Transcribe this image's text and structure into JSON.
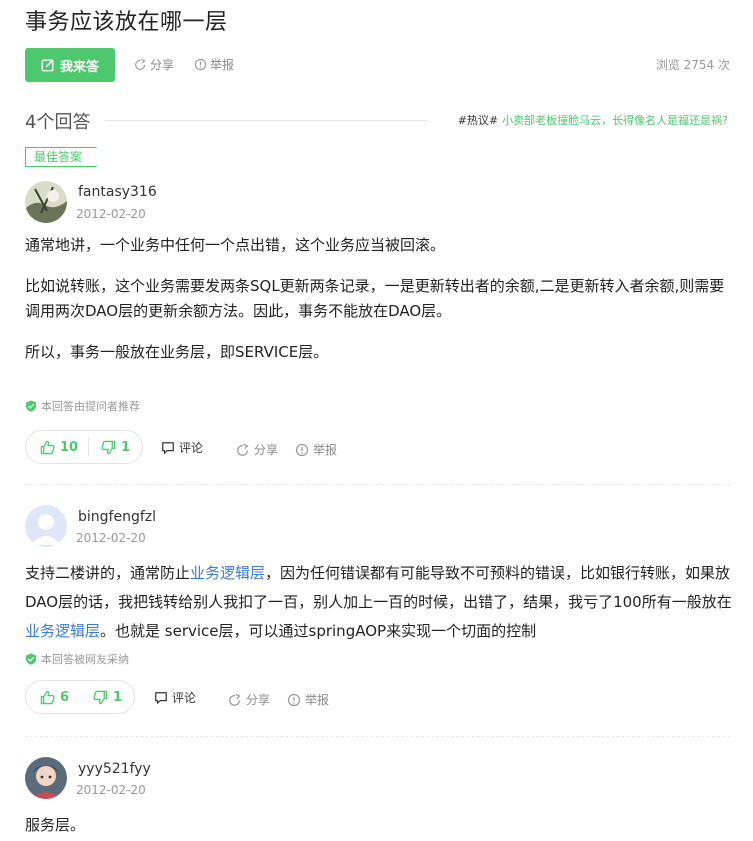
{
  "question": {
    "title": "事务应该放在哪一层",
    "answer_button": "我来答",
    "share": "分享",
    "report": "举报",
    "views": "浏览 2754 次"
  },
  "answers_header": {
    "count": "4个回答",
    "hot_tag": "#热议#",
    "hot_link": "小卖部老板撞脸马云，长得像名人是福还是祸?"
  },
  "best_badge": "最佳答案",
  "answers": [
    {
      "username": "fantasy316",
      "date": "2012-02-20",
      "paragraphs": [
        "通常地讲，一个业务中任何一个点出错，这个业务应当被回滚。",
        "比如说转账，这个业务需要发两条SQL更新两条记录，一是更新转出者的余额,二是更新转入者余额,则需要调用两次DAO层的更新余额方法。因此，事务不能放在DAO层。",
        "所以，事务一般放在业务层，即SERVICE层。"
      ],
      "recommend": "本回答由提问者推荐",
      "likes": "10",
      "dislikes": "1",
      "comment": "评论",
      "share": "分享",
      "report": "举报"
    },
    {
      "username": "bingfengfzl",
      "date": "2012-02-20",
      "text_parts": [
        "支持二楼讲的，通常防止",
        "业务逻辑层",
        "，因为任何错误都有可能导致不可预料的错误，比如银行转账，如果放DAO层的话，我把钱转给别人我扣了一百，别人加上一百的时候，出错了，结果，我亏了100所有一般放在",
        "业务逻辑层",
        "。也就是 service层，可以通过springAOP来实现一个切面的控制"
      ],
      "recommend": "本回答被网友采纳",
      "likes": "6",
      "dislikes": "1",
      "comment": "评论",
      "share": "分享",
      "report": "举报"
    },
    {
      "username": "yyy521fyy",
      "date": "2012-02-20",
      "text": "服务层。"
    }
  ],
  "colors": {
    "accent": "#4dc86f",
    "link": "#3a7bd5"
  }
}
